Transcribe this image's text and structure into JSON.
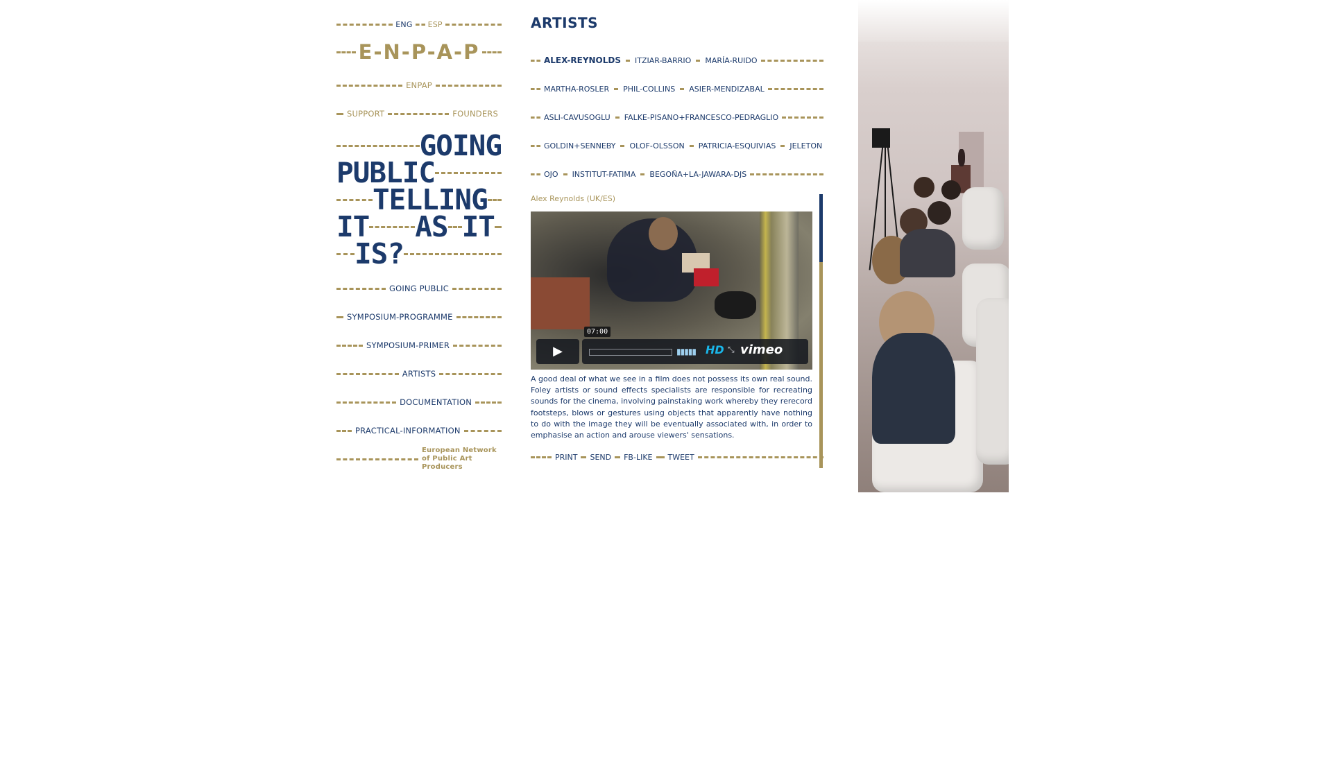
{
  "lang": {
    "eng": "ENG",
    "esp": "ESP"
  },
  "logo": "E-N-P-A-P",
  "top_nav": {
    "enpap": "ENPAP",
    "support": "SUPPORT",
    "founders": "FOUNDERS"
  },
  "title_words": [
    "GOING",
    "PUBLIC",
    "TELLING",
    "IT",
    "AS",
    "IT",
    "IS?"
  ],
  "menu": [
    "GOING PUBLIC",
    "SYMPOSIUM-PROGRAMME",
    "SYMPOSIUM-PRIMER",
    "ARTISTS",
    "DOCUMENTATION",
    "PRACTICAL-INFORMATION"
  ],
  "network_label": "European Network of Public Art Producers",
  "section_title": "ARTISTS",
  "artist_rows": [
    [
      "ALEX-REYNOLDS",
      "ITZIAR-BARRIO",
      "MARÍA-RUIDO"
    ],
    [
      "MARTHA-ROSLER",
      "PHIL-COLLINS",
      "ASIER-MENDIZABAL"
    ],
    [
      "ASLI-CAVUSOGLU",
      "FALKE-PISANO+FRANCESCO-PEDRAGLIO"
    ],
    [
      "GOLDIN+SENNEBY",
      "OLOF-OLSSON",
      "PATRICIA-ESQUIVIAS",
      "JELETON"
    ],
    [
      "OJO",
      "INSTITUT-FATIMA",
      "BEGOÑA+LA-JAWARA-DJS"
    ]
  ],
  "active_artist": "ALEX-REYNOLDS",
  "caption": "Alex Reynolds (UK/ES)",
  "video": {
    "duration": "07:00",
    "hd": "HD",
    "brand": "vimeo"
  },
  "description": "A good deal of what we see in a film does not possess its own real sound. Foley artists or sound effects specialists are responsible for recreating sounds for the cinema, involving painstaking work whereby they rerecord footsteps, blows or gestures using objects that apparently have nothing to do with the image they will be eventually associated with, in order to emphasise an action and arouse viewers' sensations.",
  "actions": {
    "print": "PRINT",
    "send": "SEND",
    "fb_like": "FB-LIKE",
    "tweet": "TWEET"
  },
  "colors": {
    "blue": "#1c3a6b",
    "gold": "#a8945a"
  }
}
